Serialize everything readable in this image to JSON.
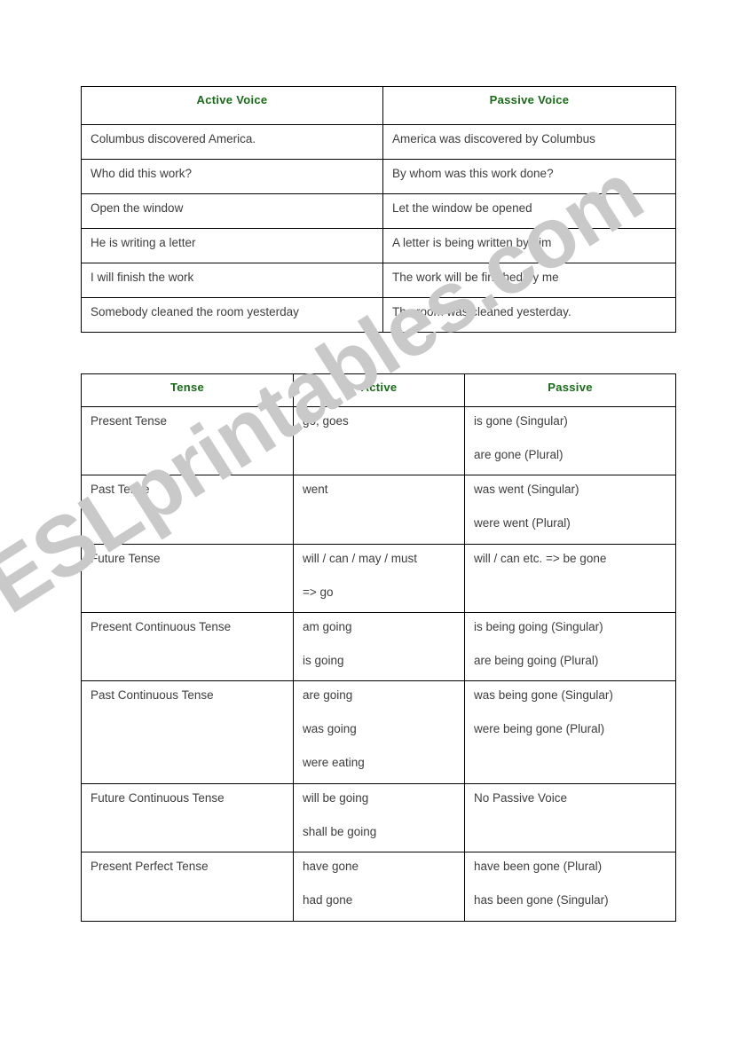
{
  "watermark": {
    "text": "ESLprintables.com",
    "color": "#c9c9c9"
  },
  "theme": {
    "header_color": "#176b17",
    "body_text_color": "#3d3d3d",
    "border_color": "#000000",
    "page_background": "#ffffff"
  },
  "voice_table": {
    "headers": [
      "Active Voice",
      "Passive Voice"
    ],
    "rows": [
      [
        "Columbus discovered America.",
        "America was discovered by Columbus"
      ],
      [
        "Who did this work?",
        "By whom was this work done?"
      ],
      [
        "Open the window",
        "Let the window be opened"
      ],
      [
        "He is writing a letter",
        "A letter is being written by him"
      ],
      [
        "I will finish the work",
        "The work will be finished by me"
      ],
      [
        "Somebody cleaned the room yesterday",
        "The room was cleaned yesterday."
      ]
    ]
  },
  "tense_table": {
    "headers": [
      "Tense",
      "Active",
      "Passive"
    ],
    "rows": [
      {
        "tense": "Present Tense",
        "active": [
          "go, goes"
        ],
        "passive": [
          "is gone (Singular)",
          "are gone (Plural)"
        ]
      },
      {
        "tense": "Past Tense",
        "active": [
          "went"
        ],
        "passive": [
          "was went (Singular)",
          "were went (Plural)"
        ]
      },
      {
        "tense": "Future Tense",
        "active": [
          "will / can / may / must",
          "=> go"
        ],
        "passive": [
          "will / can etc. => be gone"
        ]
      },
      {
        "tense": "Present Continuous Tense",
        "active": [
          "am going",
          "is going"
        ],
        "passive": [
          "is being going (Singular)",
          "are being going (Plural)"
        ]
      },
      {
        "tense": "Past Continuous Tense",
        "active": [
          "are going",
          "was going",
          "were eating"
        ],
        "passive": [
          "was being gone (Singular)",
          "were being gone (Plural)"
        ]
      },
      {
        "tense": "Future Continuous Tense",
        "active": [
          "will be going",
          "shall be going"
        ],
        "passive": [
          "No Passive Voice"
        ]
      },
      {
        "tense": "Present Perfect Tense",
        "active": [
          "have gone",
          "had gone"
        ],
        "passive": [
          "have been gone (Plural)",
          "has been gone (Singular)"
        ]
      }
    ]
  }
}
